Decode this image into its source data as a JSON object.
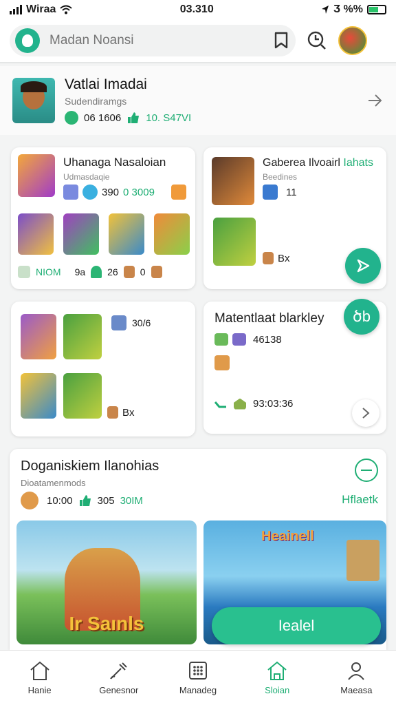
{
  "status_bar": {
    "carrier": "Wiraa",
    "time": "03.310",
    "battery_text": "Ӡ %%"
  },
  "search": {
    "placeholder": "Madan Noansi"
  },
  "profile": {
    "title": "Vatlai Imadai",
    "subtitle": "Sudendiramgs",
    "stat_1": "06 1606",
    "stat_2": "10. S47VI"
  },
  "card_a": {
    "title": "Uhanaga Nasaloian",
    "subtitle": "Udmasdaqie",
    "stat_1": "390",
    "stat_2": "0 3009",
    "footer_1": "NIOM",
    "footer_2": "9a",
    "footer_3": "26",
    "footer_4": "0"
  },
  "card_b": {
    "title": "Gaberea Ilvoairl",
    "title_accent": "Iahats",
    "subtitle": "Beedines",
    "count": "11",
    "tag": "Bx"
  },
  "card_c": {
    "count": "30/6",
    "tag": "Bx"
  },
  "card_d": {
    "title": "Matentlaat blarkley",
    "fab_label": "ծb",
    "stat": "46138",
    "time": "93:03:36"
  },
  "section": {
    "title": "Doganiskiem Ilanohias",
    "subtitle": "Dioatamenmods",
    "stat_1": "10:00",
    "stat_2": "305",
    "stat_3": "30IM",
    "link": "Hflaetk"
  },
  "banner_left": {
    "title": "Ir Saınls"
  },
  "banner_right": {
    "title": "Heainell",
    "button": "Iealel"
  },
  "nav": [
    {
      "label": "Hanie",
      "icon": "home-icon"
    },
    {
      "label": "Genesnor",
      "icon": "brush-icon"
    },
    {
      "label": "Manadeg",
      "icon": "grid-icon"
    },
    {
      "label": "Sloian",
      "icon": "store-icon",
      "active": true
    },
    {
      "label": "Maeasa",
      "icon": "person-icon"
    }
  ],
  "colors": {
    "accent": "#22b38d",
    "text": "#1d1d1d",
    "muted": "#777777"
  }
}
